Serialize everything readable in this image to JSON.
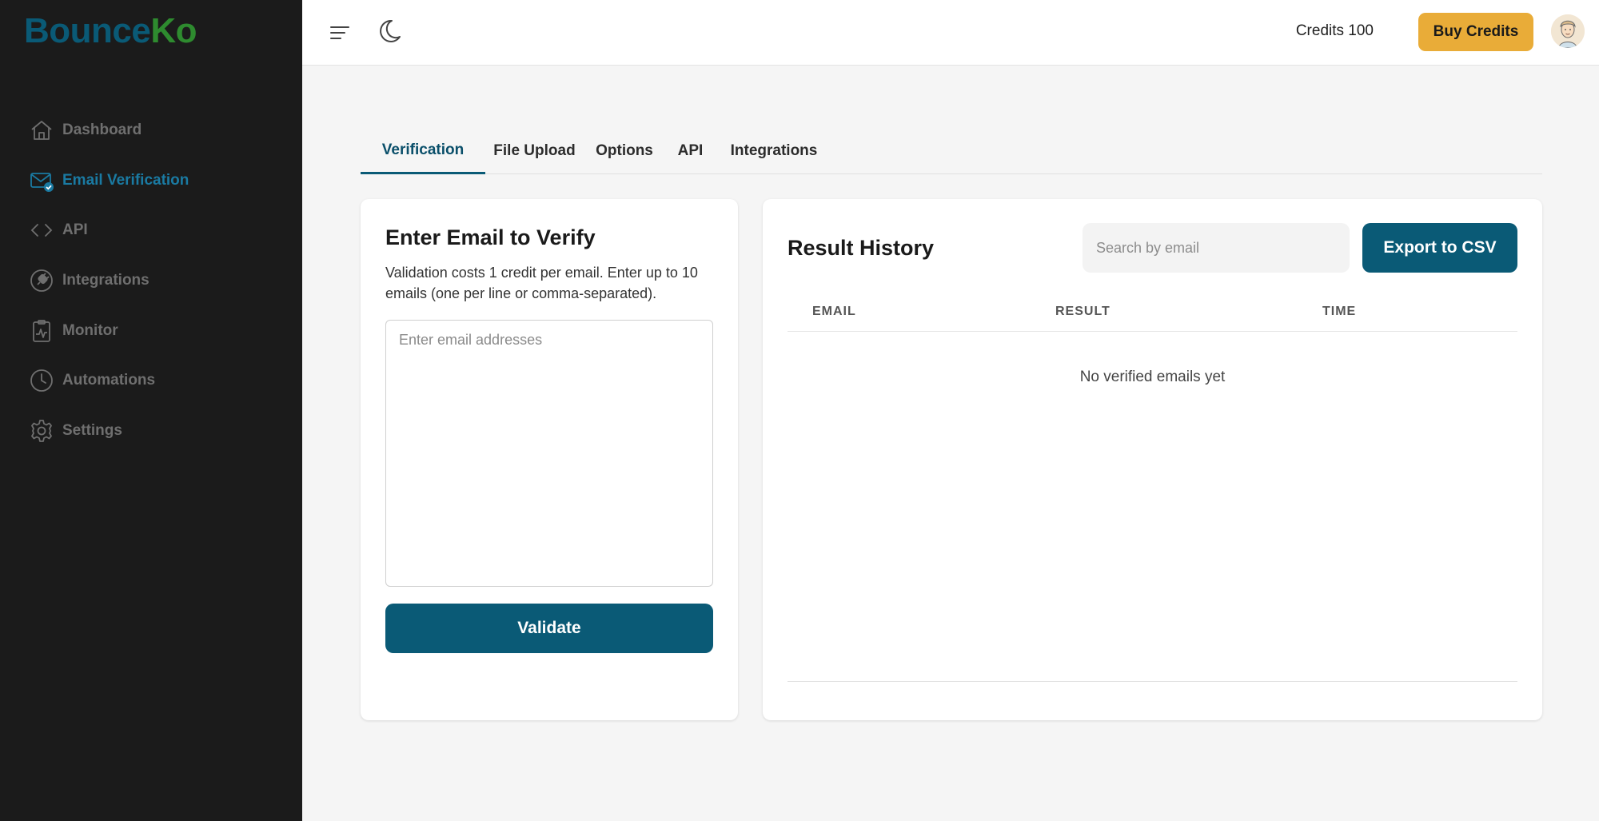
{
  "brand": {
    "part1": "Bounce",
    "part2": "Ko"
  },
  "sidebar": {
    "items": [
      {
        "label": "Dashboard",
        "icon": "home-icon",
        "active": false
      },
      {
        "label": "Email Verification",
        "icon": "email-check-icon",
        "active": true
      },
      {
        "label": "API",
        "icon": "code-icon",
        "active": false
      },
      {
        "label": "Integrations",
        "icon": "plug-icon",
        "active": false
      },
      {
        "label": "Monitor",
        "icon": "clipboard-chart-icon",
        "active": false
      },
      {
        "label": "Automations",
        "icon": "clock-icon",
        "active": false
      },
      {
        "label": "Settings",
        "icon": "gear-icon",
        "active": false
      }
    ]
  },
  "header": {
    "credits_label": "Credits 100",
    "buy_credits_label": "Buy Credits"
  },
  "tabs": [
    {
      "label": "Verification",
      "active": true
    },
    {
      "label": "File Upload",
      "active": false
    },
    {
      "label": "Options",
      "active": false
    },
    {
      "label": "API",
      "active": false
    },
    {
      "label": "Integrations",
      "active": false
    }
  ],
  "verify_card": {
    "title": "Enter Email to Verify",
    "description": "Validation costs 1 credit per email. Enter up to 10 emails (one per line or comma-separated).",
    "input_placeholder": "Enter email addresses",
    "input_value": "",
    "validate_label": "Validate"
  },
  "history_card": {
    "title": "Result History",
    "search_placeholder": "Search by email",
    "export_label": "Export to CSV",
    "columns": [
      "EMAIL",
      "RESULT",
      "TIME"
    ],
    "rows": [],
    "empty_text": "No verified emails yet"
  },
  "colors": {
    "sidebar_bg": "#1b1b1b",
    "primary": "#0a5a76",
    "active_nav": "#1a7aa2",
    "accent_buy": "#e9ac38",
    "brand_green": "#2e8b2f"
  }
}
